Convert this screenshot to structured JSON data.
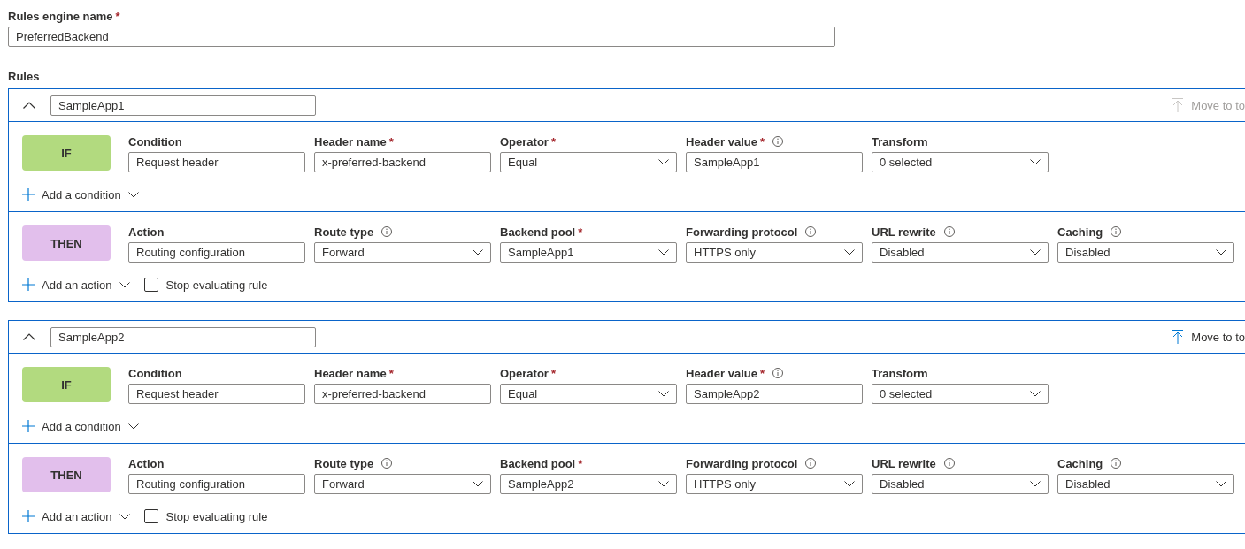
{
  "engine_name": {
    "label": "Rules engine name",
    "required_mark": "*",
    "value": "PreferredBackend"
  },
  "rules_label": "Rules",
  "rules": [
    {
      "name": "SampleApp1",
      "expanded": true,
      "move_to_top": {
        "label": "Move to to",
        "disabled": true
      },
      "sections": [
        {
          "pill": "IF",
          "kind": "condition",
          "fields": [
            {
              "label": "Condition",
              "info": false,
              "kind": "text",
              "value": "Request header"
            },
            {
              "label": "Header name",
              "required_mark": "*",
              "info": false,
              "kind": "text",
              "value": "x-preferred-backend"
            },
            {
              "label": "Operator",
              "required_mark": "*",
              "info": false,
              "kind": "dropdown",
              "value": "Equal"
            },
            {
              "label": "Header value",
              "required_mark": "*",
              "info": true,
              "kind": "text",
              "value": "SampleApp1"
            },
            {
              "label": "Transform",
              "info": false,
              "kind": "dropdown",
              "value": "0 selected"
            }
          ],
          "add": "Add a condition"
        },
        {
          "pill": "THEN",
          "kind": "action",
          "fields": [
            {
              "label": "Action",
              "info": false,
              "kind": "text",
              "value": "Routing configuration"
            },
            {
              "label": "Route type",
              "info": true,
              "kind": "dropdown",
              "value": "Forward"
            },
            {
              "label": "Backend pool",
              "required_mark": "*",
              "info": false,
              "kind": "dropdown",
              "value": "SampleApp1"
            },
            {
              "label": "Forwarding protocol",
              "info": true,
              "kind": "dropdown",
              "value": "HTTPS only"
            },
            {
              "label": "URL rewrite",
              "info": true,
              "kind": "dropdown",
              "value": "Disabled"
            },
            {
              "label": "Caching",
              "info": true,
              "kind": "dropdown",
              "value": "Disabled"
            }
          ],
          "add": "Add an action",
          "stop": {
            "label": "Stop evaluating rule",
            "checked": false
          }
        }
      ]
    },
    {
      "name": "SampleApp2",
      "expanded": true,
      "move_to_top": {
        "label": "Move to to",
        "disabled": false
      },
      "sections": [
        {
          "pill": "IF",
          "kind": "condition",
          "fields": [
            {
              "label": "Condition",
              "info": false,
              "kind": "text",
              "value": "Request header"
            },
            {
              "label": "Header name",
              "required_mark": "*",
              "info": false,
              "kind": "text",
              "value": "x-preferred-backend"
            },
            {
              "label": "Operator",
              "required_mark": "*",
              "info": false,
              "kind": "dropdown",
              "value": "Equal"
            },
            {
              "label": "Header value",
              "required_mark": "*",
              "info": true,
              "kind": "text",
              "value": "SampleApp2"
            },
            {
              "label": "Transform",
              "info": false,
              "kind": "dropdown",
              "value": "0 selected"
            }
          ],
          "add": "Add a condition"
        },
        {
          "pill": "THEN",
          "kind": "action",
          "fields": [
            {
              "label": "Action",
              "info": false,
              "kind": "text",
              "value": "Routing configuration"
            },
            {
              "label": "Route type",
              "info": true,
              "kind": "dropdown",
              "value": "Forward"
            },
            {
              "label": "Backend pool",
              "required_mark": "*",
              "info": false,
              "kind": "dropdown",
              "value": "SampleApp2"
            },
            {
              "label": "Forwarding protocol",
              "info": true,
              "kind": "dropdown",
              "value": "HTTPS only"
            },
            {
              "label": "URL rewrite",
              "info": true,
              "kind": "dropdown",
              "value": "Disabled"
            },
            {
              "label": "Caching",
              "info": true,
              "kind": "dropdown",
              "value": "Disabled"
            }
          ],
          "add": "Add an action",
          "stop": {
            "label": "Stop evaluating rule",
            "checked": false
          }
        }
      ]
    }
  ]
}
